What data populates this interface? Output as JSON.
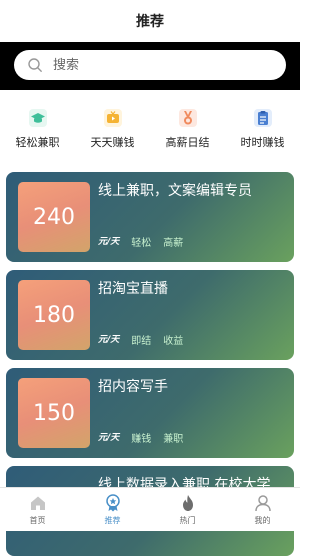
{
  "header": {
    "title": "推荐"
  },
  "search": {
    "placeholder": "搜索"
  },
  "categories": [
    {
      "label": "轻松兼职",
      "icon": "graduation-cap-icon"
    },
    {
      "label": "天天赚钱",
      "icon": "tv-icon"
    },
    {
      "label": "高薪日结",
      "icon": "medal-icon"
    },
    {
      "label": "时时赚钱",
      "icon": "clipboard-icon"
    }
  ],
  "jobs": [
    {
      "amount": "240",
      "title": "线上兼职，文案编辑专员",
      "unit": "元/天",
      "tags": [
        "轻松",
        "高薪"
      ]
    },
    {
      "amount": "180",
      "title": "招淘宝直播",
      "unit": "元/天",
      "tags": [
        "即结",
        "收益"
      ]
    },
    {
      "amount": "150",
      "title": "招内容写手",
      "unit": "元/天",
      "tags": [
        "赚钱",
        "兼职"
      ]
    },
    {
      "title": "线上数据录入兼职 在校大学"
    }
  ],
  "bottom_nav": [
    {
      "label": "首页",
      "icon": "home-icon"
    },
    {
      "label": "推荐",
      "icon": "recommend-badge-icon",
      "active": true
    },
    {
      "label": "热门",
      "icon": "flame-icon"
    },
    {
      "label": "我的",
      "icon": "user-icon"
    }
  ],
  "colors": {
    "accent": "#4a90c8",
    "card_gradient": [
      "#2f5c78",
      "#6aa15e"
    ],
    "tag_text": "#c9f2d0",
    "search_bar_bg": "#000000"
  }
}
